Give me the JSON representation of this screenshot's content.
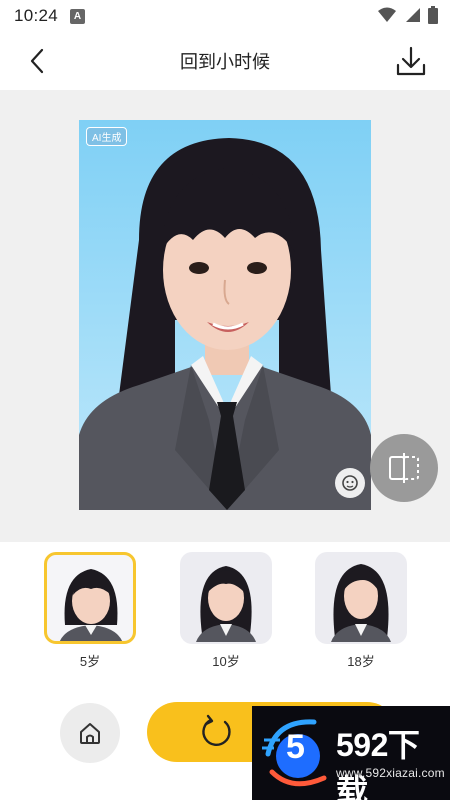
{
  "status_bar": {
    "time": "10:24",
    "notification_icon": "A",
    "icons": [
      "wifi-icon",
      "signal-icon",
      "battery-icon"
    ]
  },
  "header": {
    "title": "回到小时候",
    "back_icon": "chevron-left-icon",
    "download_icon": "download-icon"
  },
  "preview": {
    "badge": "AI生成",
    "bg_colors": [
      "#7fd0f5",
      "#b8e6fb"
    ],
    "ai_icon": "ai-face-icon",
    "compare_icon": "compare-icon"
  },
  "age_options": [
    {
      "label": "5岁",
      "selected": true
    },
    {
      "label": "10岁",
      "selected": false
    },
    {
      "label": "18岁",
      "selected": false
    }
  ],
  "bottom_bar": {
    "home_icon": "home-icon",
    "regenerate_icon": "refresh-icon",
    "accent_color": "#f9c01c"
  },
  "watermark": {
    "logo_text": "5",
    "title": "592下载",
    "url": "www.592xiazai.com"
  }
}
